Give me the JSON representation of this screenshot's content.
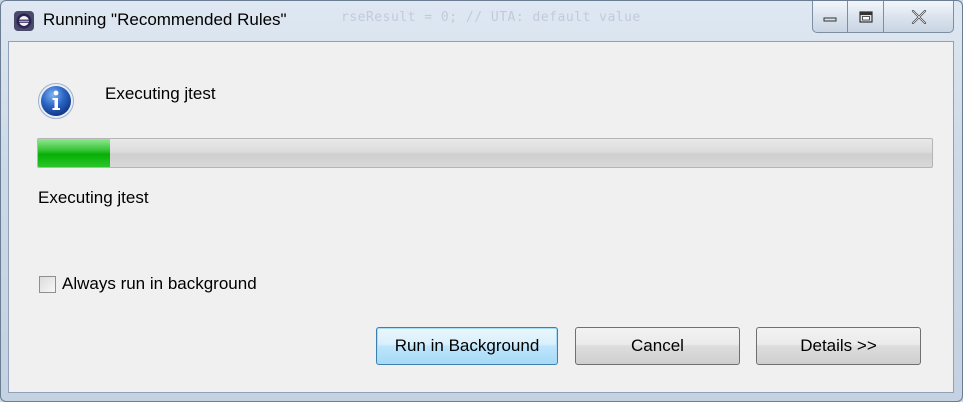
{
  "window": {
    "title": "Running \"Recommended Rules\"",
    "background_code": "rseResult = 0; // UTA: default value"
  },
  "icons": {
    "app": "eclipse-app-icon",
    "info": "info-icon",
    "minimize": "minimize-icon",
    "maximize": "maximize-icon",
    "close": "close-icon"
  },
  "dialog": {
    "task_name": "Executing jtest",
    "progress_fraction": 0.08,
    "sub_task": "Executing jtest",
    "always_background_label": "Always run in background",
    "always_background_checked": false
  },
  "buttons": {
    "run_in_background": "Run in Background",
    "cancel": "Cancel",
    "details": "Details >>"
  },
  "colors": {
    "progress_green": "#06b006",
    "default_button_border": "#3c7fb1"
  }
}
